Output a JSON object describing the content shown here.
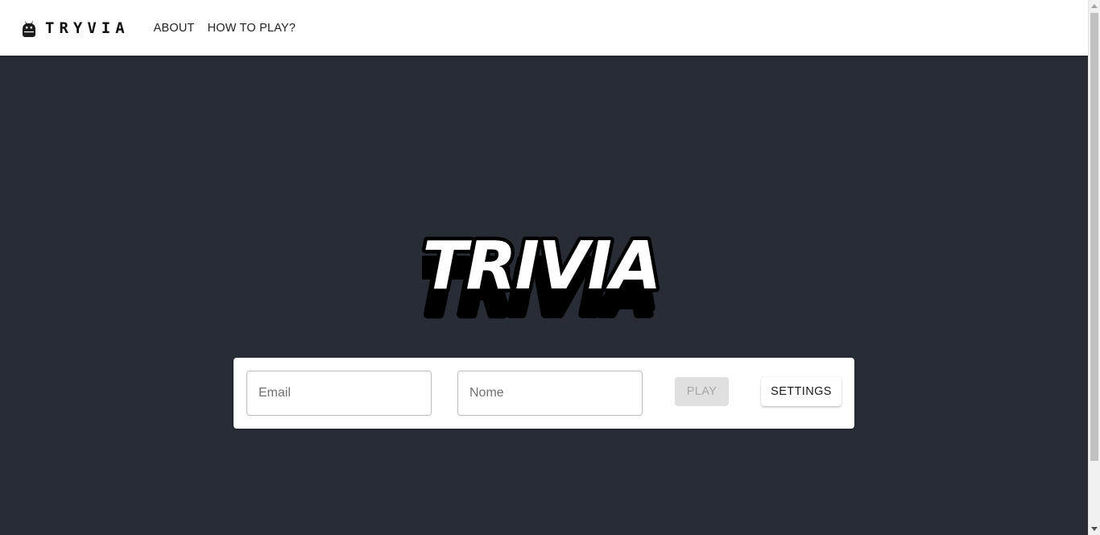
{
  "header": {
    "brand_name": "TRYVIA",
    "brand_icon": "ghost-icon",
    "nav": [
      {
        "label": "ABOUT"
      },
      {
        "label": "HOW TO PLAY?"
      }
    ]
  },
  "hero": {
    "logo_text": "TRIVIA"
  },
  "form": {
    "email_placeholder": "Email",
    "email_value": "",
    "name_placeholder": "Nome",
    "name_value": "",
    "play_label": "PLAY",
    "settings_label": "SETTINGS"
  },
  "colors": {
    "background": "#282c34",
    "appbar": "#ffffff",
    "card": "#ffffff",
    "play_disabled_bg": "#e0e0e0",
    "play_disabled_text": "#a6a6a6"
  }
}
